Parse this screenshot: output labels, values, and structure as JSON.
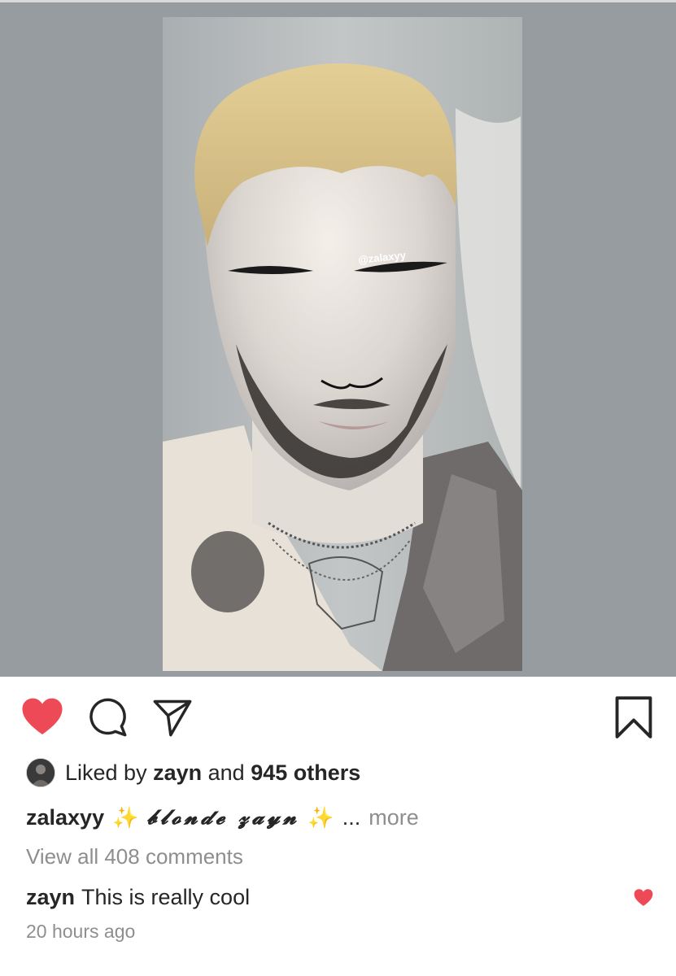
{
  "post": {
    "image_watermark": "@zalaxyy",
    "actions": {
      "liked": true,
      "like_icon": "heart-icon",
      "comment_icon": "comment-icon",
      "share_icon": "paper-plane-icon",
      "save_icon": "bookmark-icon",
      "like_color": "#ed4956"
    },
    "likes": {
      "prefix": "Liked by",
      "user": "zayn",
      "conjunction": "and",
      "count_text": "945 others"
    },
    "caption": {
      "username": "zalaxyy",
      "sparkle": "✨",
      "text": "𝓫𝓵𝓸𝓷𝓭𝓮 𝔃𝓪𝔂𝓷",
      "ellipsis": "...",
      "more_label": "more"
    },
    "view_comments_label": "View all 408 comments",
    "top_comment": {
      "username": "zayn",
      "text": "This is really cool",
      "liked": true
    },
    "timestamp": "20 hours ago"
  }
}
